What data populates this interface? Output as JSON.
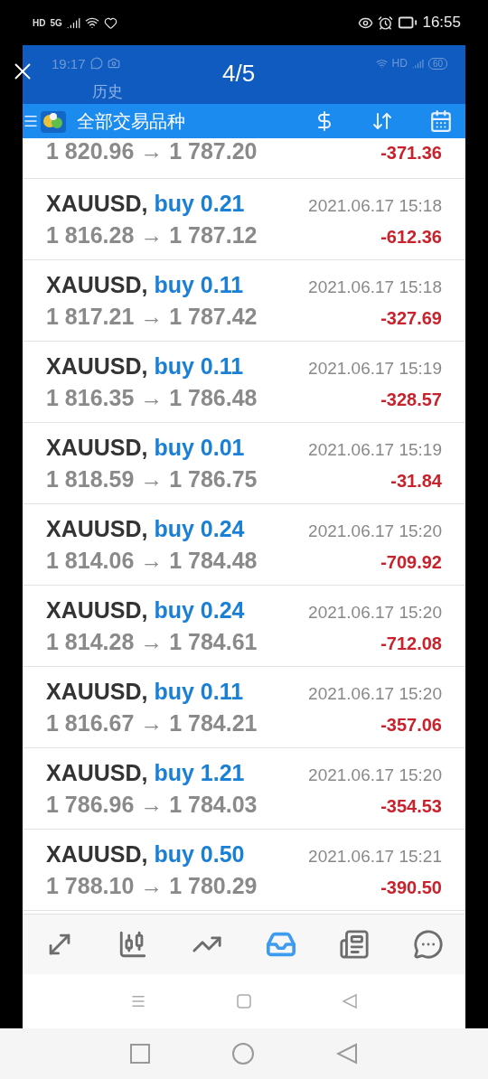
{
  "phone_status_bar": {
    "network_labels": [
      "HD",
      "5G"
    ],
    "time": "16:55"
  },
  "viewer": {
    "counter": "4/5"
  },
  "app_status_bar": {
    "time": "19:17",
    "network_label": "HD",
    "battery": "60"
  },
  "header": {
    "title": "历史",
    "filter": "全部交易品种"
  },
  "partial_row": {
    "prices": "1 820.96 → 1 787.20",
    "profit": "-371.36"
  },
  "deals": [
    {
      "symbol": "XAUUSD,",
      "order": "buy 0.21",
      "time": "2021.06.17 15:18",
      "prices": "1 816.28 → 1 787.12",
      "profit": "-612.36"
    },
    {
      "symbol": "XAUUSD,",
      "order": "buy 0.11",
      "time": "2021.06.17 15:18",
      "prices": "1 817.21 → 1 787.42",
      "profit": "-327.69"
    },
    {
      "symbol": "XAUUSD,",
      "order": "buy 0.11",
      "time": "2021.06.17 15:19",
      "prices": "1 816.35 → 1 786.48",
      "profit": "-328.57"
    },
    {
      "symbol": "XAUUSD,",
      "order": "buy 0.01",
      "time": "2021.06.17 15:19",
      "prices": "1 818.59 → 1 786.75",
      "profit": "-31.84"
    },
    {
      "symbol": "XAUUSD,",
      "order": "buy 0.24",
      "time": "2021.06.17 15:20",
      "prices": "1 814.06 → 1 784.48",
      "profit": "-709.92"
    },
    {
      "symbol": "XAUUSD,",
      "order": "buy 0.24",
      "time": "2021.06.17 15:20",
      "prices": "1 814.28 → 1 784.61",
      "profit": "-712.08"
    },
    {
      "symbol": "XAUUSD,",
      "order": "buy 0.11",
      "time": "2021.06.17 15:20",
      "prices": "1 816.67 → 1 784.21",
      "profit": "-357.06"
    },
    {
      "symbol": "XAUUSD,",
      "order": "buy 1.21",
      "time": "2021.06.17 15:20",
      "prices": "1 786.96 → 1 784.03",
      "profit": "-354.53"
    },
    {
      "symbol": "XAUUSD,",
      "order": "buy 0.50",
      "time": "2021.06.17 15:21",
      "prices": "1 788.10 → 1 780.29",
      "profit": "-390.50"
    }
  ],
  "tab_bar": [
    {
      "kind": "trade",
      "selected": false
    },
    {
      "kind": "chart",
      "selected": false
    },
    {
      "kind": "quotes",
      "selected": false
    },
    {
      "kind": "history",
      "selected": true
    },
    {
      "kind": "news",
      "selected": false
    },
    {
      "kind": "chat",
      "selected": false
    }
  ]
}
